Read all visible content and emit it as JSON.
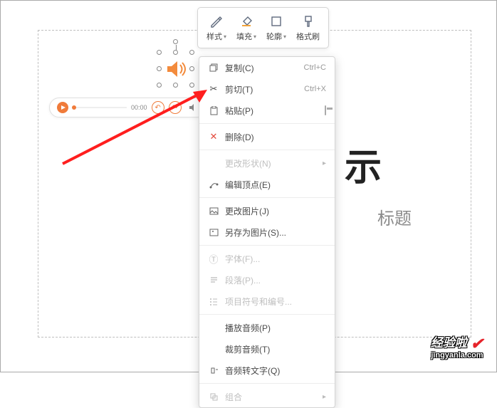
{
  "canvas": {
    "title_fragment": "示",
    "subtitle_fragment": "标题"
  },
  "toolbar": {
    "style": "样式",
    "fill": "填充",
    "outline": "轮廓",
    "format_painter": "格式刷"
  },
  "audio_bar": {
    "time": "00:00"
  },
  "context_menu": {
    "copy": "复制(C)",
    "copy_shortcut": "Ctrl+C",
    "cut": "剪切(T)",
    "cut_shortcut": "Ctrl+X",
    "paste": "粘贴(P)",
    "delete": "删除(D)",
    "change_shape": "更改形状(N)",
    "edit_points": "编辑顶点(E)",
    "change_picture": "更改图片(J)",
    "save_as_picture": "另存为图片(S)...",
    "font": "字体(F)...",
    "paragraph": "段落(P)...",
    "bullets": "项目符号和编号...",
    "play_audio": "播放音频(P)",
    "trim_audio": "裁剪音频(T)",
    "audio_to_text": "音频转文字(Q)",
    "group": "组合"
  },
  "watermark": {
    "main": "经验啦",
    "sub": "jingyanla.com"
  }
}
